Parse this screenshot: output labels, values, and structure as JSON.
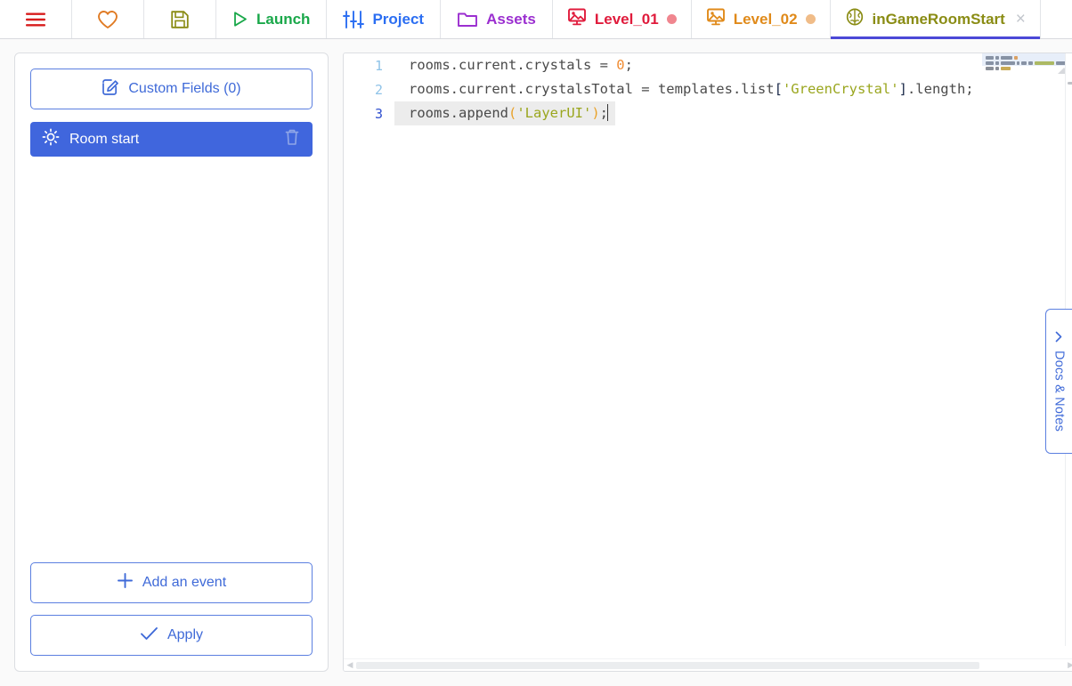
{
  "toolbar": {
    "menu_icon": "hamburger-menu-icon",
    "favorite_icon": "heart-icon",
    "save_icon": "floppy-save-icon",
    "launch_label": "Launch",
    "launch_icon": "play-triangle-icon",
    "project_label": "Project",
    "project_icon": "sliders-icon",
    "assets_label": "Assets",
    "assets_icon": "folder-icon",
    "colors": {
      "menu": "#d81d1d",
      "favorite": "#e07b24",
      "save": "#8a8c14",
      "launch": "#1aa84a",
      "project": "#2b6ef2",
      "assets": "#9b2fd0"
    }
  },
  "tabs": [
    {
      "label": "Level_01",
      "icon": "room-image-icon",
      "color": "#e01b3c",
      "dot_color": "#f0868f",
      "active": false,
      "closable": false
    },
    {
      "label": "Level_02",
      "icon": "room-image-icon",
      "color": "#e08a1a",
      "dot_color": "#f0bc88",
      "active": false,
      "closable": false
    },
    {
      "label": "inGameRoomStart",
      "icon": "brain-icon",
      "color": "#8a8c14",
      "dot_color": "",
      "active": true,
      "closable": true,
      "close_label": "×"
    }
  ],
  "active_tab_underline_color": "#4b48d6",
  "sidebar": {
    "custom_fields_label": "Custom Fields (0)",
    "custom_fields_icon": "pencil-square-icon",
    "events": [
      {
        "label": "Room start",
        "icon": "sun-icon",
        "delete_icon": "trash-icon",
        "selected": true
      }
    ],
    "add_event_label": "Add an event",
    "add_event_icon": "plus-icon",
    "apply_label": "Apply",
    "apply_icon": "check-icon",
    "accent_color": "#4066dd"
  },
  "editor": {
    "lines": [
      {
        "number": "1",
        "active": false,
        "tokens": [
          {
            "text": "rooms.current.crystals = ",
            "type": "pln"
          },
          {
            "text": "0",
            "type": "num"
          },
          {
            "text": ";",
            "type": "pln"
          }
        ]
      },
      {
        "number": "2",
        "active": false,
        "tokens": [
          {
            "text": "rooms.current.crystalsTotal = templates.list",
            "type": "pln"
          },
          {
            "text": "[",
            "type": "brk"
          },
          {
            "text": "'GreenCrystal'",
            "type": "str"
          },
          {
            "text": "]",
            "type": "brk"
          },
          {
            "text": ".length;",
            "type": "pln"
          }
        ]
      },
      {
        "number": "3",
        "active": true,
        "tokens": [
          {
            "text": "rooms.append",
            "type": "pln"
          },
          {
            "text": "(",
            "type": "par"
          },
          {
            "text": "'LayerUI'",
            "type": "str"
          },
          {
            "text": ")",
            "type": "par"
          },
          {
            "text": ";",
            "type": "pln"
          }
        ]
      }
    ],
    "syntax_colors": {
      "number": "#f08c33",
      "string": "#9aa61e",
      "bracket": "#1c2b4a",
      "paren": "#e9a22a",
      "plain": "#4a4a4a",
      "line_number": "#8fc3e8",
      "active_line_number": "#2f4fcf",
      "active_line_bg": "#ececec"
    },
    "minimap": {
      "rows": [
        [
          {
            "w": 9,
            "c": "#8a8f98"
          },
          {
            "w": 4,
            "c": "#8a8f98"
          },
          {
            "w": 13,
            "c": "#8a8f98"
          },
          {
            "w": 4,
            "c": "#f0a24a"
          }
        ],
        [
          {
            "w": 9,
            "c": "#8a8f98"
          },
          {
            "w": 4,
            "c": "#8a8f98"
          },
          {
            "w": 16,
            "c": "#8a8f98"
          },
          {
            "w": 3,
            "c": "#8a8f98"
          },
          {
            "w": 6,
            "c": "#8a8f98"
          },
          {
            "w": 5,
            "c": "#8a8f98"
          },
          {
            "w": 22,
            "c": "#b8bf4a"
          },
          {
            "w": 14,
            "c": "#8a8f98"
          }
        ],
        [
          {
            "w": 9,
            "c": "#8a8f98"
          },
          {
            "w": 4,
            "c": "#8a8f98"
          },
          {
            "w": 11,
            "c": "#c8aa55"
          }
        ]
      ]
    },
    "h_scroll_left_arrow": "◀",
    "h_scroll_right_arrow": "▶"
  },
  "docs_panel": {
    "label": "Docs & Notes",
    "chevron_icon": "chevron-left-icon",
    "color": "#3f6ad8"
  }
}
